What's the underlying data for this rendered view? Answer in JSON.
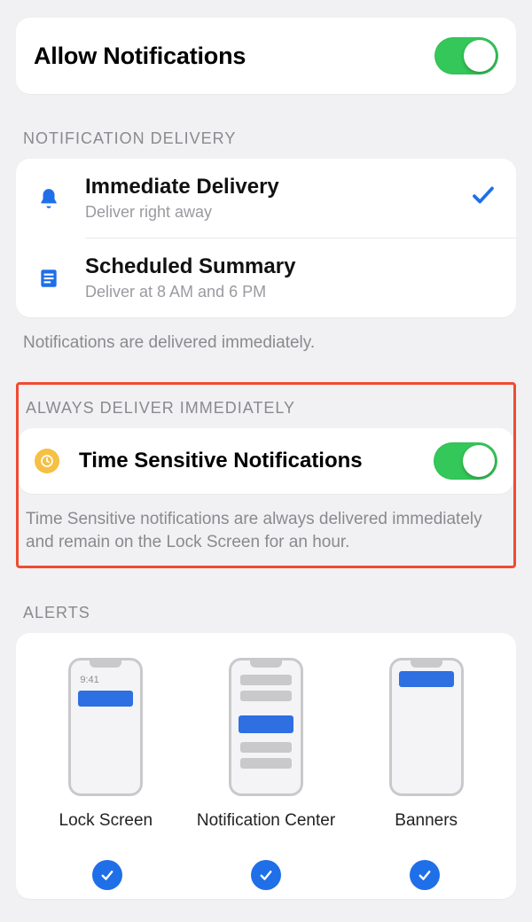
{
  "allow": {
    "title": "Allow Notifications",
    "on": true
  },
  "delivery": {
    "header": "NOTIFICATION DELIVERY",
    "items": [
      {
        "title": "Immediate Delivery",
        "subtitle": "Deliver right away",
        "icon": "bell-icon",
        "selected": true
      },
      {
        "title": "Scheduled Summary",
        "subtitle": "Deliver at 8 AM and 6 PM",
        "icon": "summary-icon",
        "selected": false
      }
    ],
    "footer": "Notifications are delivered immediately."
  },
  "always": {
    "header": "ALWAYS DELIVER IMMEDIATELY",
    "row_title": "Time Sensitive Notifications",
    "icon": "clock-icon",
    "on": true,
    "footer": "Time Sensitive notifications are always delivered immediately and remain on the Lock Screen for an hour."
  },
  "alerts": {
    "header": "ALERTS",
    "lockscreen": {
      "label": "Lock Screen",
      "clock": "9:41",
      "checked": true
    },
    "ncenter": {
      "label": "Notification Center",
      "checked": true
    },
    "banners": {
      "label": "Banners",
      "checked": true
    }
  }
}
